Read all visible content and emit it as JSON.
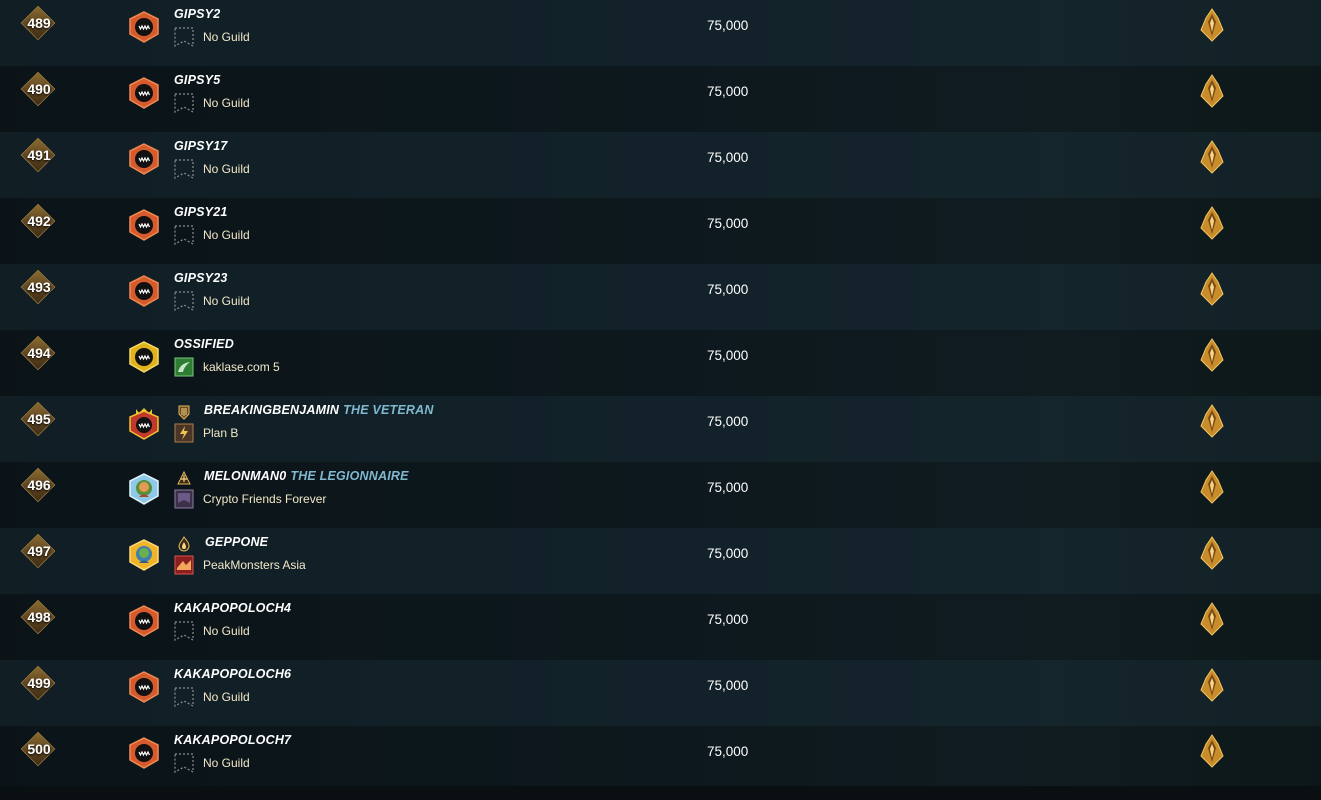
{
  "leaderboard": {
    "rows": [
      {
        "rank": "489",
        "player": "GIPSY2",
        "title": "",
        "title_icon": "",
        "avatar": "orange-monster-badge-icon",
        "guild": "No Guild",
        "guild_icon": "empty-guild-banner-icon",
        "rating": "75,000",
        "league_icon": "gold-league-crest-icon"
      },
      {
        "rank": "490",
        "player": "GIPSY5",
        "title": "",
        "title_icon": "",
        "avatar": "orange-monster-badge-icon",
        "guild": "No Guild",
        "guild_icon": "empty-guild-banner-icon",
        "rating": "75,000",
        "league_icon": "gold-league-crest-icon"
      },
      {
        "rank": "491",
        "player": "GIPSY17",
        "title": "",
        "title_icon": "",
        "avatar": "orange-monster-badge-icon",
        "guild": "No Guild",
        "guild_icon": "empty-guild-banner-icon",
        "rating": "75,000",
        "league_icon": "gold-league-crest-icon"
      },
      {
        "rank": "492",
        "player": "GIPSY21",
        "title": "",
        "title_icon": "",
        "avatar": "orange-monster-badge-icon",
        "guild": "No Guild",
        "guild_icon": "empty-guild-banner-icon",
        "rating": "75,000",
        "league_icon": "gold-league-crest-icon"
      },
      {
        "rank": "493",
        "player": "GIPSY23",
        "title": "",
        "title_icon": "",
        "avatar": "orange-monster-badge-icon",
        "guild": "No Guild",
        "guild_icon": "empty-guild-banner-icon",
        "rating": "75,000",
        "league_icon": "gold-league-crest-icon"
      },
      {
        "rank": "494",
        "player": "OSSIFIED",
        "title": "",
        "title_icon": "",
        "avatar": "gold-monster-badge-icon",
        "guild": "kaklase.com 5",
        "guild_icon": "green-tree-guild-icon",
        "rating": "75,000",
        "league_icon": "gold-league-crest-icon"
      },
      {
        "rank": "495",
        "player": "BREAKINGBENJAMIN",
        "title": "THE VETERAN",
        "title_icon": "veteran-title-icon",
        "avatar": "crowned-monster-badge-icon",
        "guild": "Plan B",
        "guild_icon": "lightning-guild-icon",
        "rating": "75,000",
        "league_icon": "gold-league-crest-icon"
      },
      {
        "rank": "496",
        "player": "MELONMAN0",
        "title": "THE LEGIONNAIRE",
        "title_icon": "legionnaire-title-icon",
        "avatar": "custom-portrait-avatar-icon",
        "guild": "Crypto Friends Forever",
        "guild_icon": "purple-guild-banner-icon",
        "rating": "75,000",
        "league_icon": "gold-league-crest-icon"
      },
      {
        "rank": "497",
        "player": "GEPPONE",
        "title": "",
        "title_icon": "flame-title-icon",
        "avatar": "gold-portrait-avatar-icon",
        "guild": "PeakMonsters Asia",
        "guild_icon": "red-guild-banner-icon",
        "rating": "75,000",
        "league_icon": "gold-league-crest-icon"
      },
      {
        "rank": "498",
        "player": "KAKAPOPOLOCH4",
        "title": "",
        "title_icon": "",
        "avatar": "orange-monster-badge-icon",
        "guild": "No Guild",
        "guild_icon": "empty-guild-banner-icon",
        "rating": "75,000",
        "league_icon": "gold-league-crest-icon"
      },
      {
        "rank": "499",
        "player": "KAKAPOPOLOCH6",
        "title": "",
        "title_icon": "",
        "avatar": "orange-monster-badge-icon",
        "guild": "No Guild",
        "guild_icon": "empty-guild-banner-icon",
        "rating": "75,000",
        "league_icon": "gold-league-crest-icon"
      },
      {
        "rank": "500",
        "player": "KAKAPOPOLOCH7",
        "title": "",
        "title_icon": "",
        "avatar": "orange-monster-badge-icon",
        "guild": "No Guild",
        "guild_icon": "empty-guild-banner-icon",
        "rating": "75,000",
        "league_icon": "gold-league-crest-icon"
      }
    ]
  },
  "colors": {
    "player_name": "#ffffff",
    "player_title": "#7fb8cf",
    "guild_text": "#f2e8c8",
    "rank_badge": "#6b4e22",
    "league_gold": "#d9a441"
  }
}
